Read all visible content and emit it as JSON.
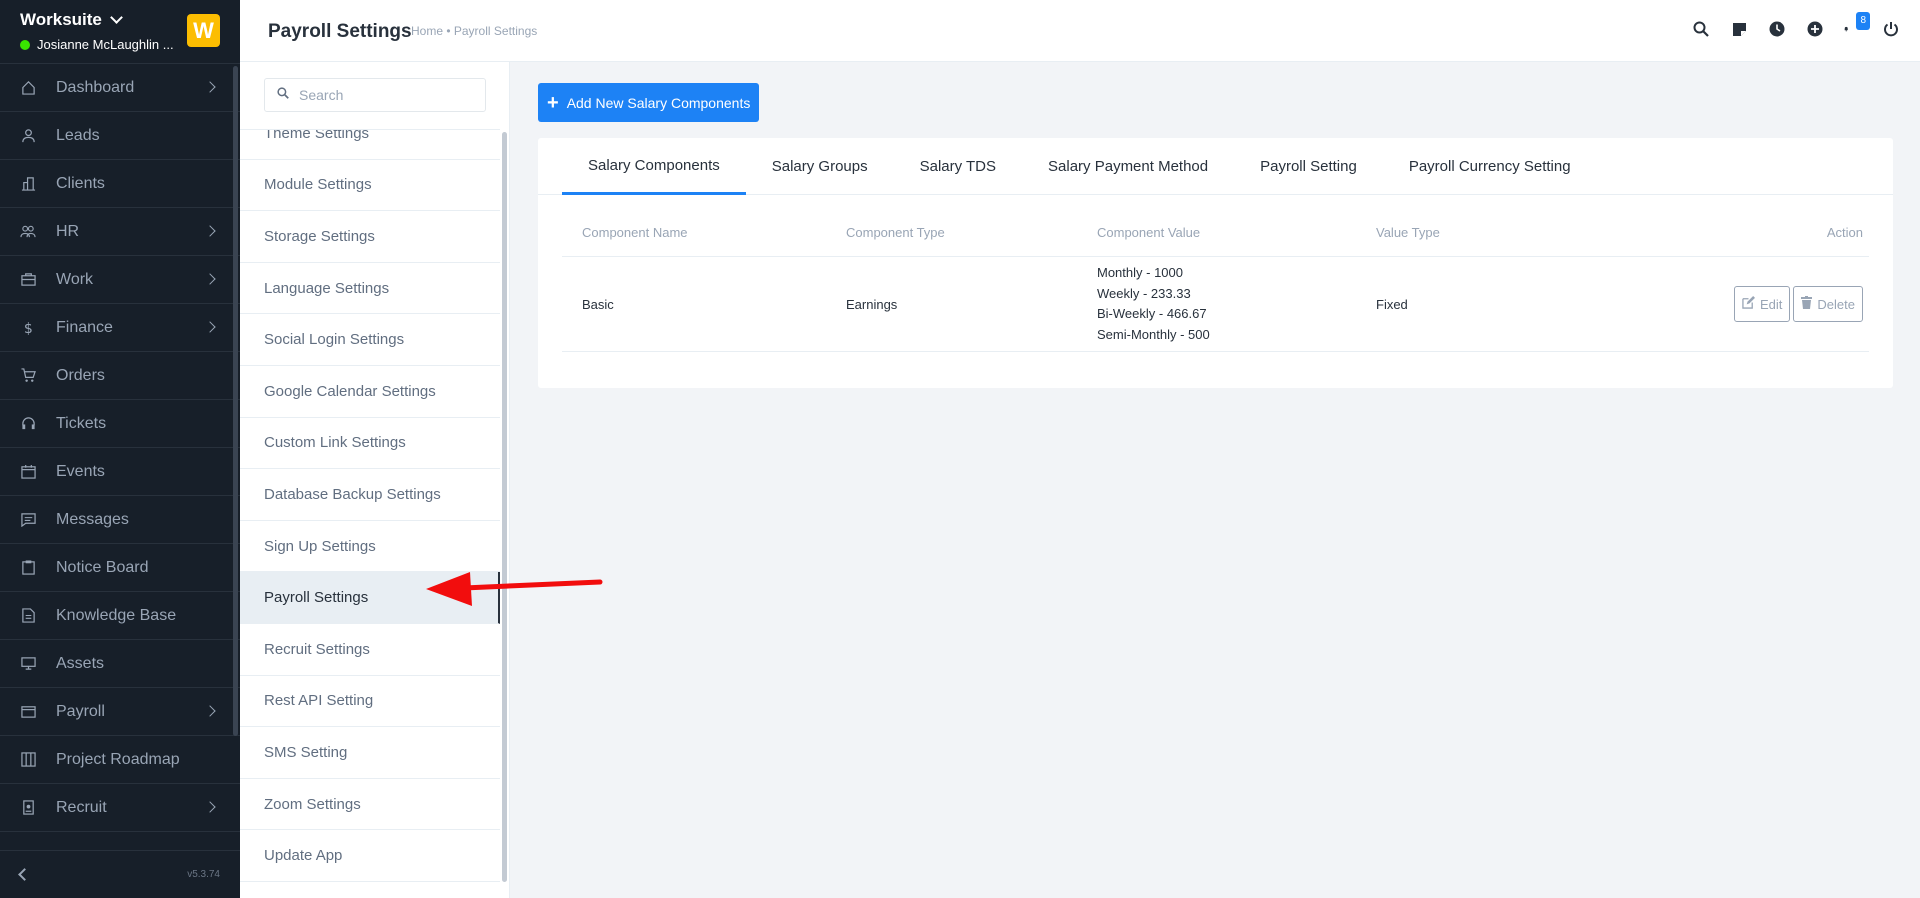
{
  "app": {
    "brand_name": "Worksuite",
    "user_name": "Josianne McLaughlin ...",
    "logo_letter": "W",
    "version": "v5.3.74"
  },
  "sidebar": {
    "items": [
      {
        "label": "Dashboard",
        "icon": "house-icon",
        "has_arrow": true
      },
      {
        "label": "Leads",
        "icon": "person-icon",
        "has_arrow": false
      },
      {
        "label": "Clients",
        "icon": "building-icon",
        "has_arrow": false
      },
      {
        "label": "HR",
        "icon": "people-icon",
        "has_arrow": true
      },
      {
        "label": "Work",
        "icon": "briefcase-icon",
        "has_arrow": true
      },
      {
        "label": "Finance",
        "icon": "dollar-icon",
        "has_arrow": true
      },
      {
        "label": "Orders",
        "icon": "cart-icon",
        "has_arrow": false
      },
      {
        "label": "Tickets",
        "icon": "headset-icon",
        "has_arrow": false
      },
      {
        "label": "Events",
        "icon": "calendar-icon",
        "has_arrow": false
      },
      {
        "label": "Messages",
        "icon": "chat-icon",
        "has_arrow": false
      },
      {
        "label": "Notice Board",
        "icon": "clipboard-icon",
        "has_arrow": false
      },
      {
        "label": "Knowledge Base",
        "icon": "document-icon",
        "has_arrow": false
      },
      {
        "label": "Assets",
        "icon": "monitor-icon",
        "has_arrow": false
      },
      {
        "label": "Payroll",
        "icon": "wallet-icon",
        "has_arrow": true
      },
      {
        "label": "Project Roadmap",
        "icon": "columns-icon",
        "has_arrow": false
      },
      {
        "label": "Recruit",
        "icon": "badge-icon",
        "has_arrow": true
      }
    ]
  },
  "header": {
    "title": "Payroll Settings",
    "breadcrumb": "Home • Payroll Settings",
    "notification_count": "8"
  },
  "settings_menu": {
    "search_placeholder": "Search",
    "items": [
      "Theme Settings",
      "Module Settings",
      "Storage Settings",
      "Language Settings",
      "Social Login Settings",
      "Google Calendar Settings",
      "Custom Link Settings",
      "Database Backup Settings",
      "Sign Up Settings",
      "Payroll Settings",
      "Recruit Settings",
      "Rest API Setting",
      "SMS Setting",
      "Zoom Settings",
      "Update App"
    ],
    "active": "Payroll Settings"
  },
  "main": {
    "add_button_label": "Add New Salary Components",
    "tabs": [
      "Salary Components",
      "Salary Groups",
      "Salary TDS",
      "Salary Payment Method",
      "Payroll Setting",
      "Payroll Currency Setting"
    ],
    "active_tab": "Salary Components",
    "table": {
      "headers": [
        "Component Name",
        "Component Type",
        "Component Value",
        "Value Type",
        "Action"
      ],
      "rows": [
        {
          "name": "Basic",
          "type": "Earnings",
          "values": [
            "Monthly - 1000",
            "Weekly - 233.33",
            "Bi-Weekly - 466.67",
            "Semi-Monthly - 500"
          ],
          "value_type": "Fixed",
          "edit_label": "Edit",
          "delete_label": "Delete"
        }
      ]
    }
  },
  "colors": {
    "sidebar_bg": "#171f29",
    "accent": "#1d82f5",
    "logo": "#fcbd01",
    "online": "#39e500",
    "annotation_arrow": "#ff0000"
  }
}
